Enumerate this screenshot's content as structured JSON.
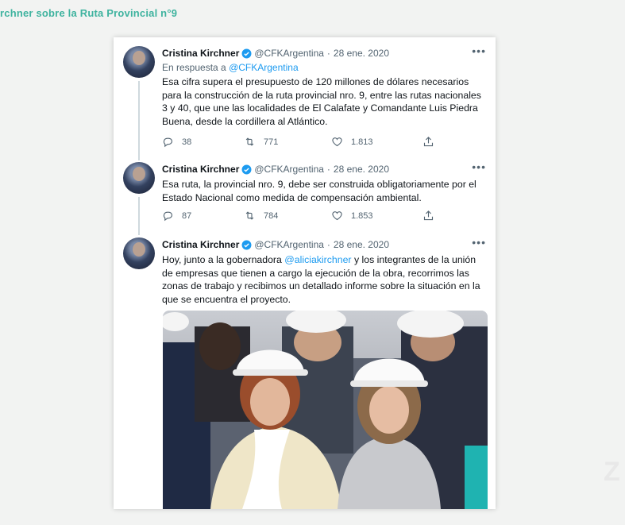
{
  "page": {
    "title": "rchner sobre la Ruta Provincial n°9"
  },
  "tweets": [
    {
      "name": "Cristina Kirchner",
      "handle": "@CFKArgentina",
      "dot": "·",
      "date": "28 ene. 2020",
      "reply_prefix": "En respuesta a",
      "reply_to": "@CFKArgentina",
      "text": "Esa cifra supera el presupuesto de 120 millones de dólares necesarios para la construcción de la ruta provincial nro. 9, entre las rutas nacionales 3 y 40, que une las localidades de El Calafate y Comandante Luis Piedra Buena, desde la cordillera al Atlántico.",
      "replies": "38",
      "retweets": "771",
      "likes": "1.813"
    },
    {
      "name": "Cristina Kirchner",
      "handle": "@CFKArgentina",
      "dot": "·",
      "date": "28 ene. 2020",
      "text": "Esa ruta, la provincial nro. 9, debe ser construida obligatoriamente por el Estado Nacional como medida de compensación ambiental.",
      "replies": "87",
      "retweets": "784",
      "likes": "1.853"
    },
    {
      "name": "Cristina Kirchner",
      "handle": "@CFKArgentina",
      "dot": "·",
      "date": "28 ene. 2020",
      "text_before": "Hoy, junto a la gobernadora ",
      "mention": "@aliciakirchner",
      "text_after": " y los integrantes de la unión de empresas que tienen a cargo la ejecución de la obra, recorrimos las zonas de trabajo y recibimos un detallado informe sobre la situación en la que se encuentra el proyecto."
    }
  ],
  "icons": {
    "more": "more-icon",
    "reply": "reply-icon",
    "retweet": "retweet-icon",
    "like": "heart-icon",
    "share": "share-icon",
    "verified": "verified-badge-icon"
  },
  "colors": {
    "title": "#3fb39f",
    "link": "#1d9bf0",
    "text": "#0f1419",
    "muted": "#536471"
  }
}
